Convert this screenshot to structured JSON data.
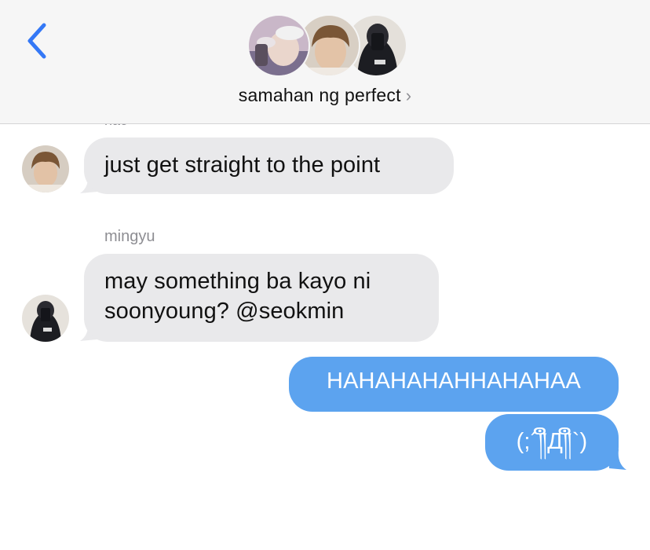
{
  "header": {
    "back_icon": "chevron-left-icon",
    "group_name": "samahan ng perfect",
    "avatars": [
      "person-with-headband",
      "person-brown-hair",
      "person-mirror-selfie-hoodie"
    ]
  },
  "messages": [
    {
      "sender": "hao",
      "text": "just get straight to the point",
      "direction": "incoming",
      "sender_cut": true
    },
    {
      "sender": "mingyu",
      "lines": [
        "may something ba kayo ni",
        "soonyoung? @seokmin"
      ],
      "direction": "incoming"
    },
    {
      "text": "HAHAHAHAHHAHAHAA",
      "direction": "outgoing"
    },
    {
      "text": "(;´༎ຶД༎ຶ`)",
      "direction": "outgoing"
    }
  ],
  "colors": {
    "header_bg": "#f6f6f6",
    "incoming_bubble": "#e9e9eb",
    "outgoing_bubble": "#5ca3ef",
    "accent_blue": "#3478f6",
    "sender_gray": "#8e8e93"
  }
}
